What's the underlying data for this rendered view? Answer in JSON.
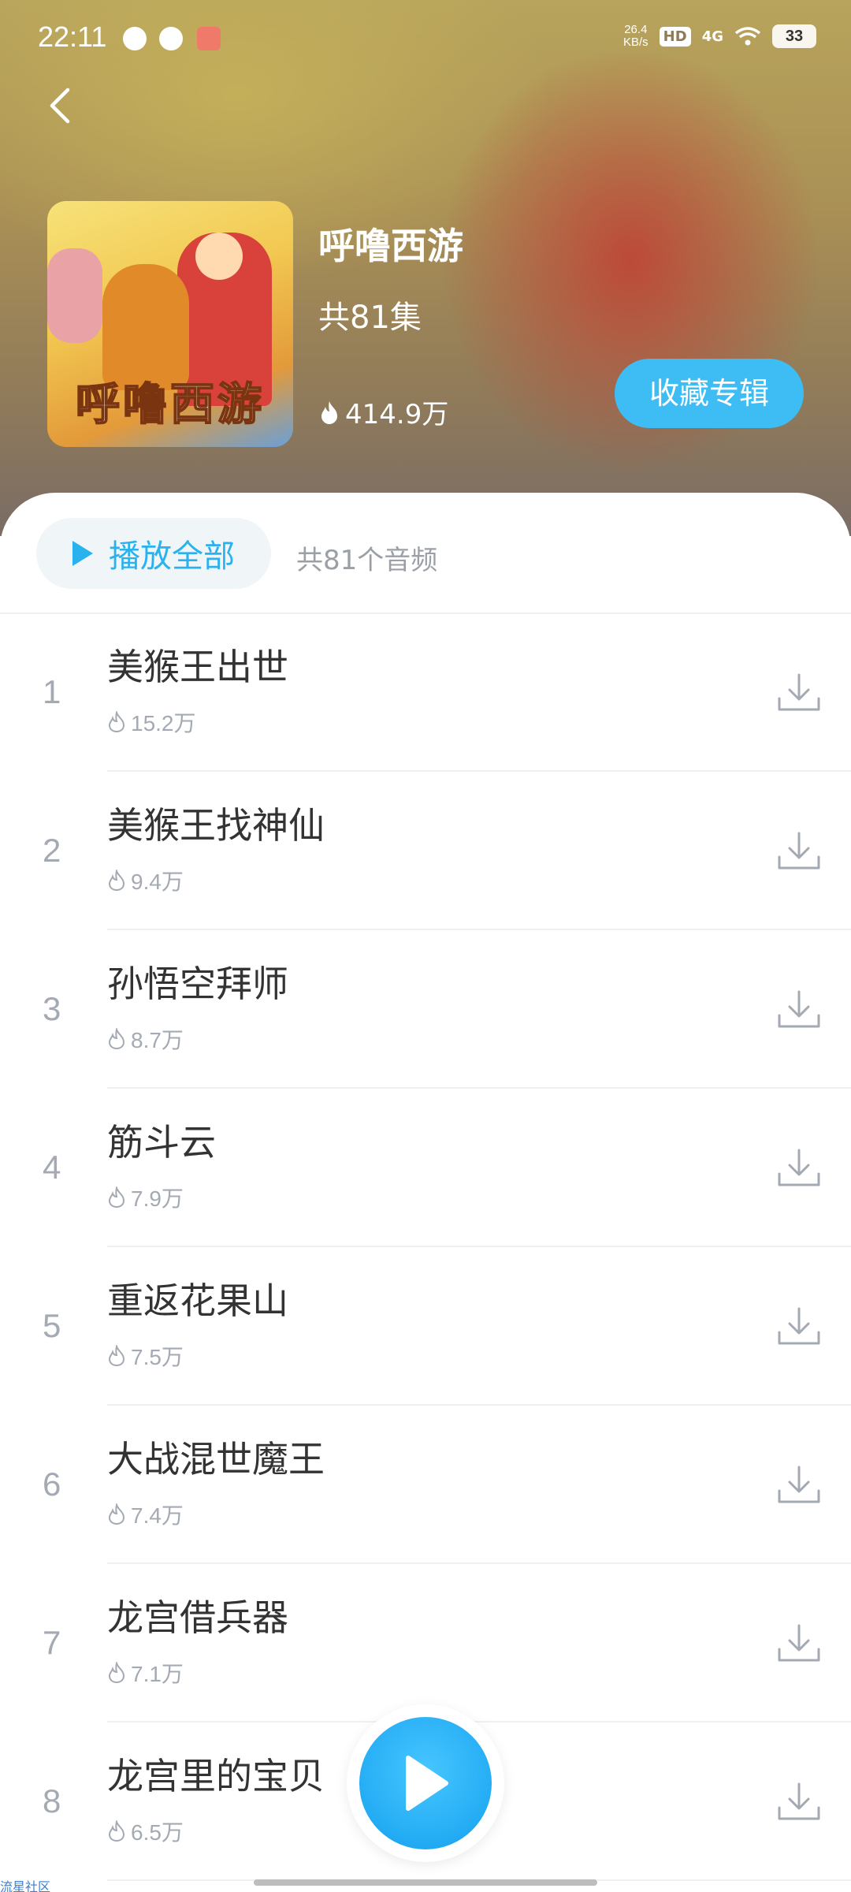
{
  "status_bar": {
    "time": "22:11",
    "net_speed_value": "26.4",
    "net_speed_unit": "KB/s",
    "hd": "HD",
    "signal": "4G",
    "battery": "33"
  },
  "album": {
    "title": "呼噜西游",
    "cover_logo": "呼噜西游",
    "episodes": "共81集",
    "plays": "414.9万",
    "collect_label": "收藏专辑"
  },
  "list_header": {
    "play_all_label": "播放全部",
    "audio_count": "共81个音频"
  },
  "tracks": [
    {
      "num": "1",
      "title": "美猴王出世",
      "plays": "15.2万"
    },
    {
      "num": "2",
      "title": "美猴王找神仙",
      "plays": "9.4万"
    },
    {
      "num": "3",
      "title": "孙悟空拜师",
      "plays": "8.7万"
    },
    {
      "num": "4",
      "title": "筋斗云",
      "plays": "7.9万"
    },
    {
      "num": "5",
      "title": "重返花果山",
      "plays": "7.5万"
    },
    {
      "num": "6",
      "title": "大战混世魔王",
      "plays": "7.4万"
    },
    {
      "num": "7",
      "title": "龙宫借兵器",
      "plays": "7.1万"
    },
    {
      "num": "8",
      "title": "龙宫里的宝贝",
      "plays": "6.5万"
    }
  ],
  "watermark": "流星社区",
  "colors": {
    "accent": "#3dbdf3",
    "play_all_text": "#2ab2ee",
    "muted": "#a4aab3"
  },
  "icons": {
    "back": "chevron-left-icon",
    "flame": "flame-icon",
    "download": "download-icon",
    "play": "play-icon"
  }
}
